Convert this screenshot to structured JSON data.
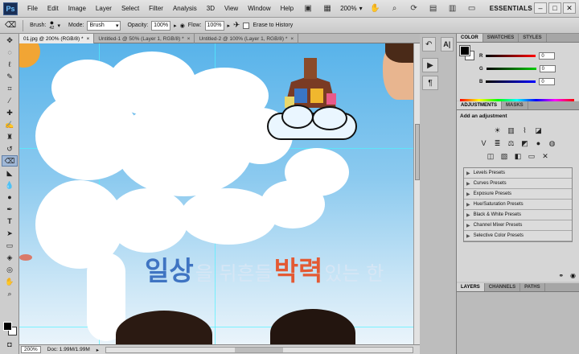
{
  "menubar": {
    "logo": "Ps",
    "items": [
      "File",
      "Edit",
      "Image",
      "Layer",
      "Select",
      "Filter",
      "Analysis",
      "3D",
      "View",
      "Window",
      "Help"
    ],
    "zoom_level": "200%",
    "workspace": "ESSENTIALS"
  },
  "options": {
    "brush_label": "Brush:",
    "brush_size": "42",
    "mode_label": "Mode:",
    "mode_value": "Brush",
    "opacity_label": "Opacity:",
    "opacity_value": "100%",
    "flow_label": "Flow:",
    "flow_value": "100%",
    "erase_history_label": "Erase to History"
  },
  "tabs": [
    {
      "label": "01.jpg @ 200% (RGB/8) *",
      "active": true
    },
    {
      "label": "Untitled-1 @ 50% (Layer 1, RGB/8) *",
      "active": false
    },
    {
      "label": "Untitled-2 @ 100% (Layer 1, RGB/8) *",
      "active": false
    }
  ],
  "canvas": {
    "korean_text_1": "일상",
    "korean_text_2": "을 뒤흔들",
    "korean_text_3": "박력",
    "korean_text_4": "있는 한"
  },
  "status": {
    "zoom": "200%",
    "doc_info": "Doc: 1.99M/1.99M"
  },
  "color_panel": {
    "tabs": [
      "COLOR",
      "SWATCHES",
      "STYLES"
    ],
    "channels": [
      {
        "label": "R",
        "value": "0",
        "color": "#e02020"
      },
      {
        "label": "G",
        "value": "0",
        "color": "#20b020"
      },
      {
        "label": "B",
        "value": "0",
        "color": "#2040e0"
      }
    ]
  },
  "adjustments_panel": {
    "tabs": [
      "ADJUSTMENTS",
      "MASKS"
    ],
    "title": "Add an adjustment",
    "presets": [
      "Levels Presets",
      "Curves Presets",
      "Exposure Presets",
      "Hue/Saturation Presets",
      "Black & White Presets",
      "Channel Mixer Presets",
      "Selective Color Presets"
    ]
  },
  "layers_panel": {
    "tabs": [
      "LAYERS",
      "CHANNELS",
      "PATHS"
    ]
  }
}
